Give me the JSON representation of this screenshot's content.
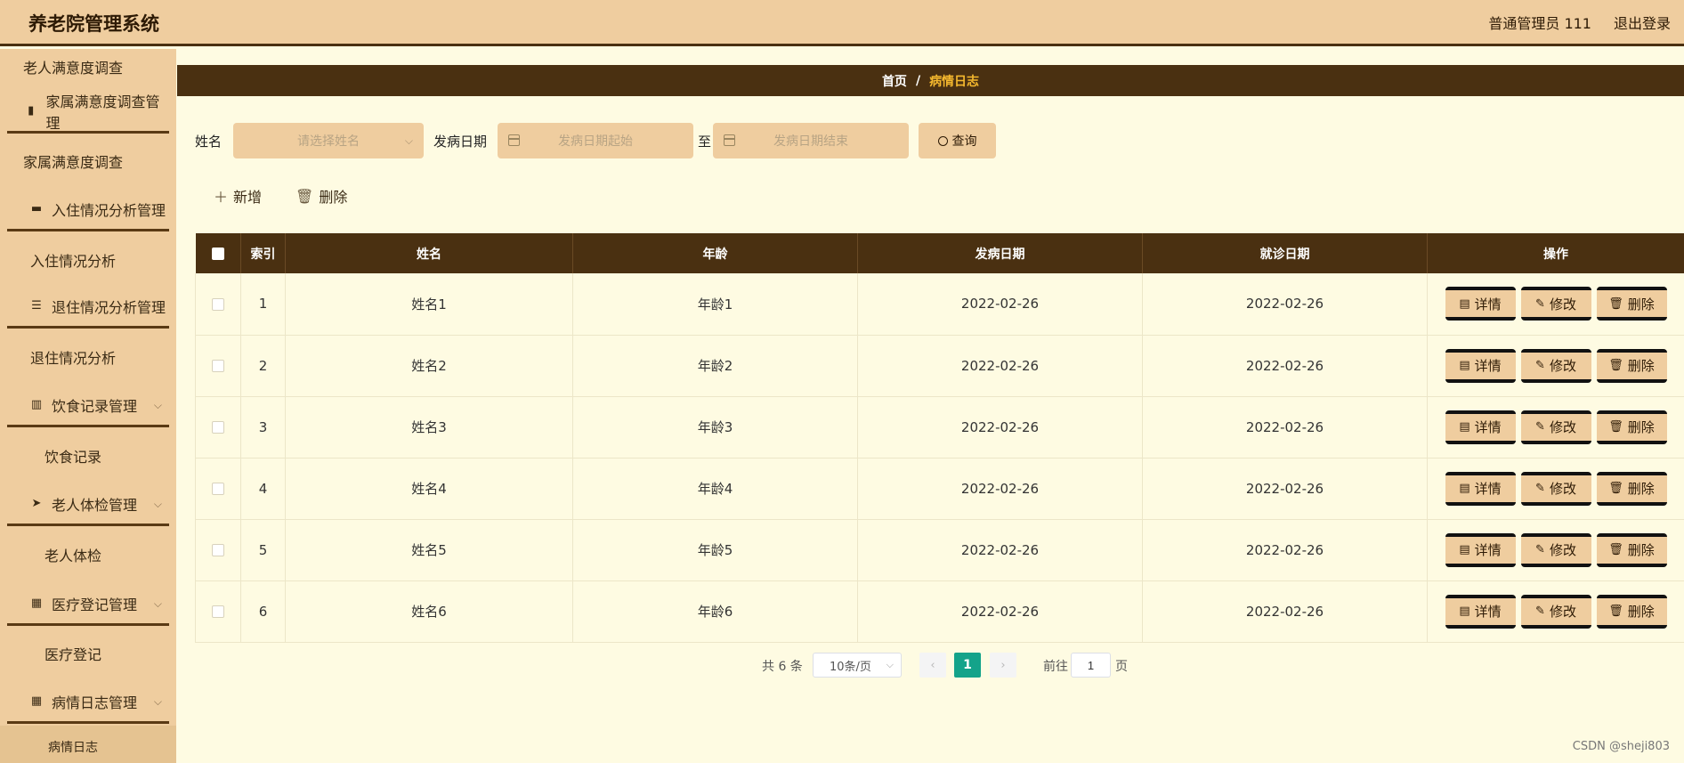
{
  "header": {
    "app_title": "养老院管理系统",
    "user_label": "普通管理员 111",
    "logout": "退出登录"
  },
  "sidebar": {
    "items": [
      {
        "label": "老人满意度调查",
        "type": "sub"
      },
      {
        "label": "家属满意度调查管理",
        "type": "group",
        "icon": "book-icon"
      },
      {
        "label": "家属满意度调查",
        "type": "sub"
      },
      {
        "label": "入住情况分析管理",
        "type": "group",
        "icon": "chat-icon"
      },
      {
        "label": "入住情况分析",
        "type": "sub"
      },
      {
        "label": "退住情况分析管理",
        "type": "group",
        "icon": "list-icon"
      },
      {
        "label": "退住情况分析",
        "type": "sub"
      },
      {
        "label": "饮食记录管理",
        "type": "group",
        "icon": "bar-chart-icon"
      },
      {
        "label": "饮食记录",
        "type": "sub"
      },
      {
        "label": "老人体检管理",
        "type": "group",
        "icon": "paper-plane-icon"
      },
      {
        "label": "老人体检",
        "type": "sub"
      },
      {
        "label": "医疗登记管理",
        "type": "group",
        "icon": "grid-icon"
      },
      {
        "label": "医疗登记",
        "type": "sub"
      },
      {
        "label": "病情日志管理",
        "type": "group",
        "icon": "grid-icon"
      },
      {
        "label": "病情日志",
        "type": "sub",
        "active": true
      }
    ]
  },
  "breadcrumb": {
    "home": "首页",
    "separator": "/",
    "current": "病情日志"
  },
  "search": {
    "name_label": "姓名",
    "name_placeholder": "请选择姓名",
    "date_label": "发病日期",
    "date_start_placeholder": "发病日期起始",
    "date_to": "至",
    "date_end_placeholder": "发病日期结束",
    "query_button": "查询"
  },
  "toolbar": {
    "add": "新增",
    "delete": "删除"
  },
  "table": {
    "headers": [
      "索引",
      "姓名",
      "年龄",
      "发病日期",
      "就诊日期",
      "操作"
    ],
    "rows": [
      {
        "index": "1",
        "name": "姓名1",
        "age": "年龄1",
        "onset": "2022-02-26",
        "visit": "2022-02-26"
      },
      {
        "index": "2",
        "name": "姓名2",
        "age": "年龄2",
        "onset": "2022-02-26",
        "visit": "2022-02-26"
      },
      {
        "index": "3",
        "name": "姓名3",
        "age": "年龄3",
        "onset": "2022-02-26",
        "visit": "2022-02-26"
      },
      {
        "index": "4",
        "name": "姓名4",
        "age": "年龄4",
        "onset": "2022-02-26",
        "visit": "2022-02-26"
      },
      {
        "index": "5",
        "name": "姓名5",
        "age": "年龄5",
        "onset": "2022-02-26",
        "visit": "2022-02-26"
      },
      {
        "index": "6",
        "name": "姓名6",
        "age": "年龄6",
        "onset": "2022-02-26",
        "visit": "2022-02-26"
      }
    ],
    "actions": {
      "detail": "详情",
      "edit": "修改",
      "delete": "删除"
    }
  },
  "pagination": {
    "total": "共 6 条",
    "page_size": "10条/页",
    "current_page": "1",
    "goto_label": "前往",
    "goto_value": "1",
    "page_unit": "页"
  },
  "watermark": "CSDN @sheji803",
  "colors": {
    "header_bg": "#efcd9f",
    "dark_brown": "#4a3011",
    "page_bg": "#fefbe2",
    "breadcrumb_current": "#f5b82e",
    "pagination_active": "#14a38a"
  }
}
